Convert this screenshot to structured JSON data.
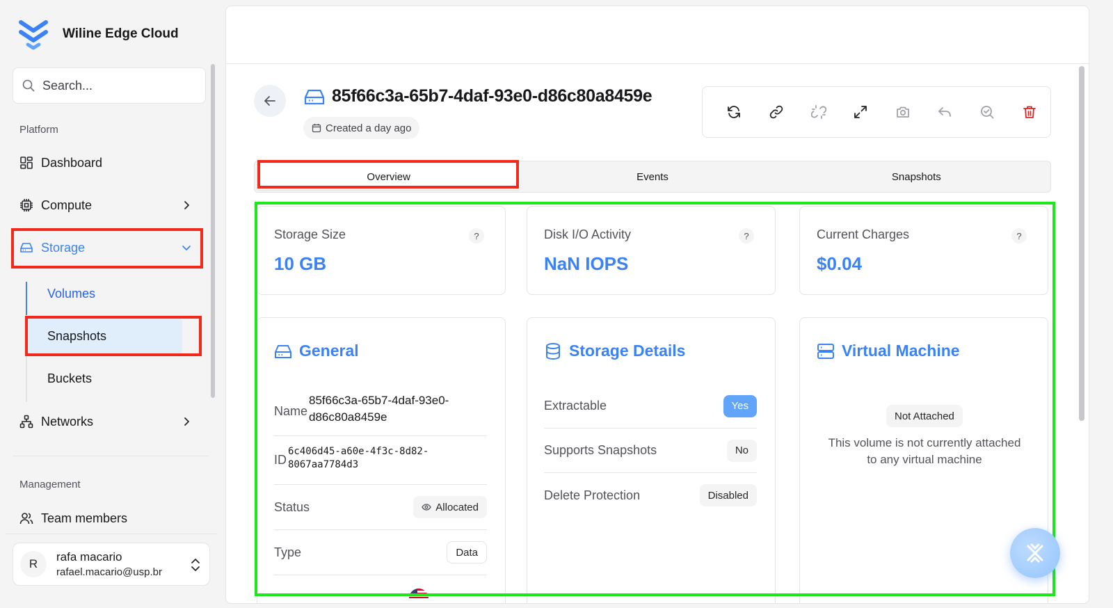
{
  "brand": {
    "name": "Wiline Edge Cloud"
  },
  "search": {
    "placeholder": "Search..."
  },
  "sidebar": {
    "platform_label": "Platform",
    "management_label": "Management",
    "items": [
      {
        "label": "Dashboard",
        "icon": "dashboard-icon"
      },
      {
        "label": "Compute",
        "icon": "cpu-icon"
      },
      {
        "label": "Storage",
        "icon": "storage-icon"
      },
      {
        "label": "Networks",
        "icon": "network-icon"
      },
      {
        "label": "Team members",
        "icon": "users-icon"
      }
    ],
    "storage_sub": [
      "Volumes",
      "Snapshots",
      "Buckets"
    ]
  },
  "user": {
    "initial": "R",
    "name": "rafa macario",
    "email": "rafael.macario@usp.br"
  },
  "volume": {
    "title": "85f66c3a-65b7-4daf-93e0-d86c80a8459e",
    "created": "Created a day ago"
  },
  "toolbar": {
    "actions": [
      "refresh-icon",
      "attach-link-icon",
      "detach-link-icon",
      "resize-icon",
      "snapshot-camera-icon",
      "revert-icon",
      "inspect-icon",
      "delete-trash-icon"
    ]
  },
  "tabs": [
    "Overview",
    "Events",
    "Snapshots"
  ],
  "stats": [
    {
      "label": "Storage Size",
      "value": "10 GB",
      "help": "?"
    },
    {
      "label": "Disk I/O Activity",
      "value": "NaN IOPS",
      "help": "?"
    },
    {
      "label": "Current Charges",
      "value": "$0.04",
      "help": "?"
    }
  ],
  "general": {
    "title": "General",
    "name_label": "Name",
    "name_line1": "85f66c3a-65b7-4daf-93e0-",
    "name_line2": "d86c80a8459e",
    "id_label": "ID",
    "id_line1": "6c406d45-a60e-4f3c-8d82-",
    "id_line2": "8067aa7784d3",
    "status_label": "Status",
    "status_value": "Allocated",
    "type_label": "Type",
    "type_value": "Data"
  },
  "storage_details": {
    "title": "Storage Details",
    "rows": [
      {
        "label": "Extractable",
        "value": "Yes"
      },
      {
        "label": "Supports Snapshots",
        "value": "No"
      },
      {
        "label": "Delete Protection",
        "value": "Disabled"
      }
    ]
  },
  "virtual_machine": {
    "title": "Virtual Machine",
    "badge": "Not Attached",
    "message_line1": "This volume is not currently attached",
    "message_line2": "to any virtual machine"
  },
  "colors": {
    "accent": "#3b82f6",
    "highlight_red": "#f2291a",
    "highlight_green": "#1ee81a",
    "danger": "#dc2626"
  }
}
